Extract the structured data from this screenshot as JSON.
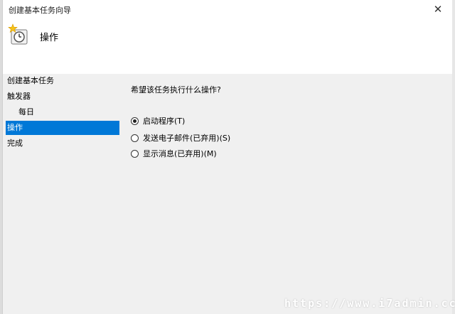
{
  "window": {
    "title": "创建基本任务向导",
    "close_icon": "close-icon"
  },
  "header": {
    "title": "操作",
    "icon": "task-clock-icon"
  },
  "nav": {
    "items": [
      {
        "label": "创建基本任务"
      },
      {
        "label": "触发器"
      },
      {
        "label": "每日"
      },
      {
        "label": "操作"
      },
      {
        "label": "完成"
      }
    ]
  },
  "main": {
    "question": "希望该任务执行什么操作?",
    "options": [
      {
        "label": "启动程序(T)",
        "selected": true
      },
      {
        "label": "发送电子邮件(已弃用)(S)",
        "selected": false
      },
      {
        "label": "显示消息(已弃用)(M)",
        "selected": false
      }
    ]
  },
  "watermark": "https://www.i7admin.cc",
  "colors": {
    "accent": "#0078d7",
    "panel_bg": "#f0f0f0",
    "header_bg": "#ffffff"
  }
}
